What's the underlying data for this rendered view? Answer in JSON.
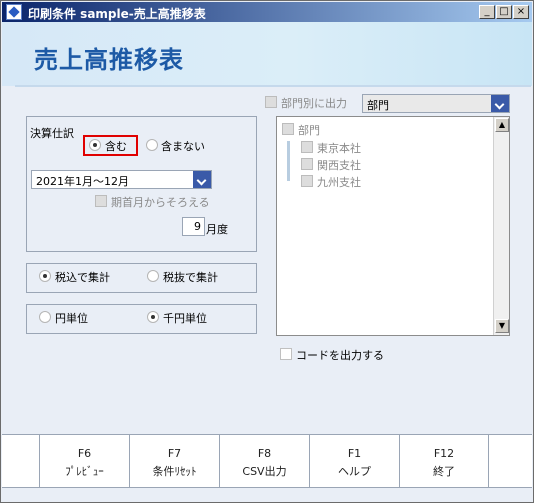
{
  "window": {
    "title": "印刷条件 sample-売上高推移表",
    "minimize": "_",
    "maximize": "□",
    "close": "×"
  },
  "header": {
    "title": "売上高推移表"
  },
  "settlement": {
    "label": "決算仕訳",
    "include_label": "含む",
    "exclude_label": "含まない",
    "selected": "include"
  },
  "period": {
    "value": "2021年1月～12月",
    "align_start_label": "期首月からそろえる",
    "degree_value": "9",
    "degree_unit": "月度"
  },
  "tax": {
    "inclusive_label": "税込で集計",
    "exclusive_label": "税抜で集計",
    "selected": "inclusive"
  },
  "unit": {
    "yen_label": "円単位",
    "thousand_label": "千円単位",
    "selected": "thousand"
  },
  "department": {
    "output_label": "部門別に出力",
    "select_value": "部門",
    "tree_root": "部門",
    "items": [
      "東京本社",
      "関西支社",
      "九州支社"
    ]
  },
  "code_output_label": "コードを出力する",
  "function_keys": [
    {
      "key": "F6",
      "label": "ﾌﾟﾚﾋﾞｭｰ"
    },
    {
      "key": "F7",
      "label": "条件ﾘｾｯﾄ"
    },
    {
      "key": "F8",
      "label": "CSV出力"
    },
    {
      "key": "F1",
      "label": "ヘルプ"
    },
    {
      "key": "F12",
      "label": "終了"
    }
  ],
  "colors": {
    "accent": "#1d5aa6",
    "highlight": "#e00000",
    "select_button": "#3a5aa8"
  }
}
